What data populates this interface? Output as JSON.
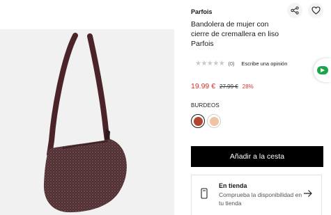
{
  "product": {
    "brand": "Parfois",
    "title": "Bandolera de mujer con cierre de cremallera en liso Parfois",
    "image_alt": "Bolso bandolera burdeos"
  },
  "icons": {
    "share": "share-icon",
    "favorite": "heart-icon",
    "store": "phone-store-icon",
    "arrow": "arrow-right-icon"
  },
  "rating": {
    "stars": "★★★★★",
    "count": "(0)",
    "write_review": "Escribe una opinión"
  },
  "price": {
    "current": "19.99 €",
    "original": "27.99 €",
    "discount": "28%"
  },
  "color": {
    "label": "BURDEOS",
    "swatches": [
      "#b2452d",
      "#efc3a4"
    ]
  },
  "cta": {
    "add_to_cart": "Añadir a la cesta"
  },
  "store": {
    "title": "En tienda",
    "subtitle": "Comprueba la disponibilidad en tu tienda"
  },
  "colors": {
    "accent": "#d6312b",
    "cta_bg": "#000000",
    "chat_green": "#1aa64a"
  }
}
